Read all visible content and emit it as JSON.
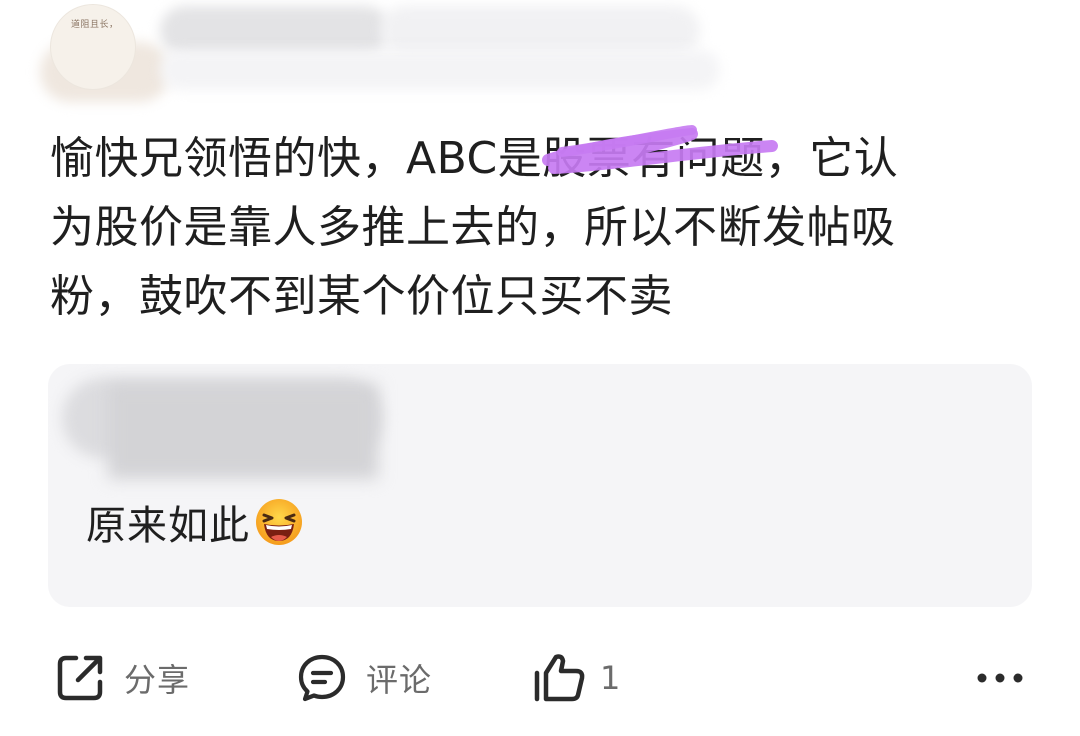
{
  "header": {
    "avatar_text": "道阻且长，"
  },
  "post": {
    "text_line1_part1": "愉快兄领悟的快，ABC是",
    "text_line1_struck": "股票有问题",
    "text_line1_part2": "，它认",
    "text_line2": "为股价是靠人多推上去的，所以不断发帖吸",
    "text_line3": "粉，鼓吹不到某个价位只买不卖",
    "scribble_color": "#c77bf2"
  },
  "reply": {
    "text": "原来如此",
    "emoji": "laughing-emoji"
  },
  "actions": {
    "share_label": "分享",
    "share_icon": "share-icon",
    "comment_label": "评论",
    "comment_icon": "comment-icon",
    "like_count": "1",
    "like_icon": "thumbs-up-icon",
    "more_icon": "more-dots-icon"
  }
}
